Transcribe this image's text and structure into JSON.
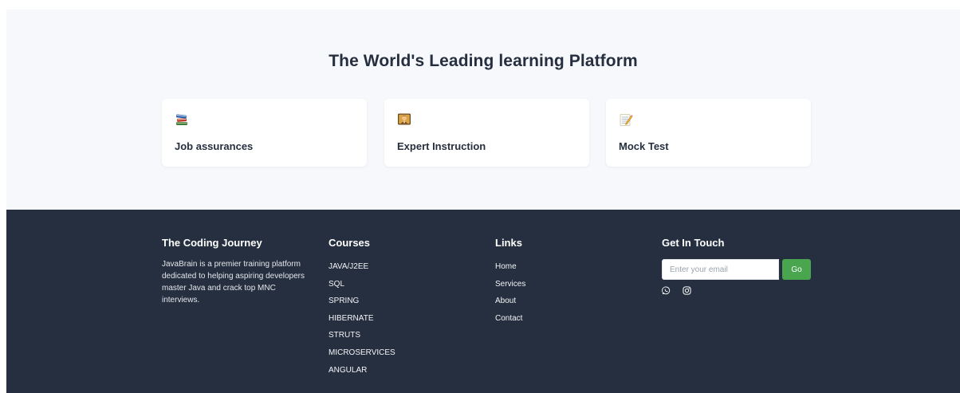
{
  "hero": {
    "title": "The World's Leading learning Platform",
    "features": [
      {
        "icon": "books-icon",
        "label": "Job assurances"
      },
      {
        "icon": "teacher-icon",
        "label": "Expert Instruction"
      },
      {
        "icon": "memo-icon",
        "label": "Mock Test"
      }
    ]
  },
  "footer": {
    "brand": {
      "title": "The Coding Journey",
      "description": "JavaBrain is a premier training platform dedicated to helping aspiring developers master Java and crack top MNC interviews."
    },
    "courses": {
      "title": "Courses",
      "items": [
        "JAVA/J2EE",
        "SQL",
        "SPRING",
        "HIBERNATE",
        "STRUTS",
        "MICROSERVICES",
        "ANGULAR"
      ]
    },
    "links": {
      "title": "Links",
      "items": [
        "Home",
        "Services",
        "About",
        "Contact"
      ]
    },
    "contact": {
      "title": "Get In Touch",
      "email_placeholder": "Enter your email",
      "email_value": "",
      "submit_label": "Go",
      "social": [
        "whatsapp-icon",
        "instagram-icon"
      ]
    }
  },
  "colors": {
    "hero_bg": "#f6f8fb",
    "footer_bg": "#252f3f",
    "accent_green": "#4aa54f",
    "heading_text": "#252f3f"
  }
}
